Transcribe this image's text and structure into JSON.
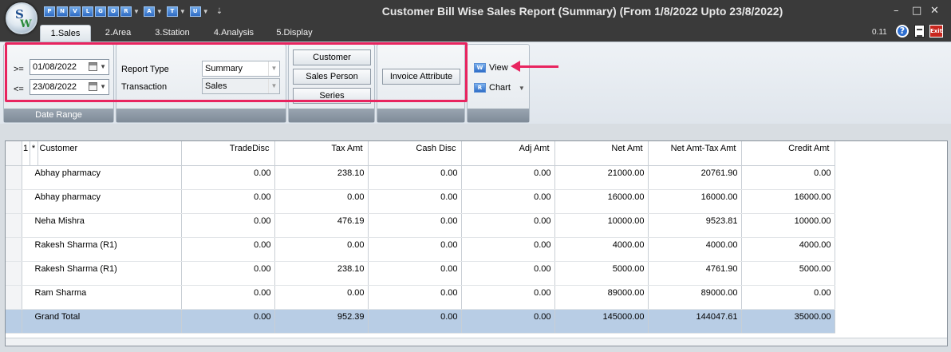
{
  "app": {
    "title": "Customer Bill Wise Sales Report (Summary) (From 1/8/2022 Upto 23/8/2022)",
    "logo_letters": [
      "S",
      "W"
    ],
    "version": "0.11",
    "help_label": "?",
    "exit_label": "Exit"
  },
  "quick_access": [
    {
      "label": "P",
      "icon": "print-icon",
      "has_dropdown": false
    },
    {
      "label": "N",
      "icon": "new-icon",
      "has_dropdown": false
    },
    {
      "label": "V",
      "icon": "view-icon",
      "has_dropdown": false
    },
    {
      "label": "L",
      "icon": "list-icon",
      "has_dropdown": false
    },
    {
      "label": "G",
      "icon": "graph-icon",
      "has_dropdown": false
    },
    {
      "label": "O",
      "icon": "options-icon",
      "has_dropdown": false
    },
    {
      "label": "R",
      "icon": "report-icon",
      "has_dropdown": true
    },
    {
      "label": "A",
      "icon": "analysis-icon",
      "has_dropdown": true
    },
    {
      "label": "T",
      "icon": "tools-icon",
      "has_dropdown": true
    },
    {
      "label": "U",
      "icon": "utility-icon",
      "has_dropdown": true
    }
  ],
  "window_controls": {
    "minimize": "–",
    "maximize": "□",
    "close": "✕"
  },
  "tabs": [
    {
      "label": "1.Sales",
      "active": true
    },
    {
      "label": "2.Area",
      "active": false
    },
    {
      "label": "3.Station",
      "active": false
    },
    {
      "label": "4.Analysis",
      "active": false
    },
    {
      "label": "5.Display",
      "active": false
    }
  ],
  "ribbon": {
    "date_range": {
      "group_label": "Date Range",
      "from_op": ">=",
      "from_value": "01/08/2022",
      "to_op": "<=",
      "to_value": "23/08/2022"
    },
    "report": {
      "report_type_label": "Report Type",
      "report_type_value": "Summary",
      "transaction_label": "Transaction",
      "transaction_value": "Sales"
    },
    "filters": {
      "customer": "Customer",
      "sales_person": "Sales Person",
      "series": "Series"
    },
    "invoice_attribute": "Invoice Attribute",
    "view": {
      "label": "View",
      "icon_text": "W"
    },
    "chart": {
      "label": "Chart",
      "icon_text": "R"
    }
  },
  "grid": {
    "row_header_num": "1",
    "row_header_star": "*",
    "columns": [
      "Customer",
      "TradeDisc",
      "Tax Amt",
      "Cash Disc",
      "Adj Amt",
      "Net Amt",
      "Net Amt-Tax Amt",
      "Credit Amt"
    ],
    "rows": [
      [
        "Abhay pharmacy",
        "0.00",
        "238.10",
        "0.00",
        "0.00",
        "21000.00",
        "20761.90",
        "0.00"
      ],
      [
        "Abhay pharmacy",
        "0.00",
        "0.00",
        "0.00",
        "0.00",
        "16000.00",
        "16000.00",
        "16000.00"
      ],
      [
        "Neha Mishra",
        "0.00",
        "476.19",
        "0.00",
        "0.00",
        "10000.00",
        "9523.81",
        "10000.00"
      ],
      [
        "Rakesh Sharma (R1)",
        "0.00",
        "0.00",
        "0.00",
        "0.00",
        "4000.00",
        "4000.00",
        "4000.00"
      ],
      [
        "Rakesh Sharma (R1)",
        "0.00",
        "238.10",
        "0.00",
        "0.00",
        "5000.00",
        "4761.90",
        "5000.00"
      ],
      [
        "Ram Sharma",
        "0.00",
        "0.00",
        "0.00",
        "0.00",
        "89000.00",
        "89000.00",
        "0.00"
      ]
    ],
    "total": [
      "Grand Total",
      "0.00",
      "952.39",
      "0.00",
      "0.00",
      "145000.00",
      "144047.61",
      "35000.00"
    ]
  },
  "colors": {
    "annotation": "#e8245f",
    "total_row": "#b8cde5",
    "title_bar": "#3a3a3a"
  }
}
